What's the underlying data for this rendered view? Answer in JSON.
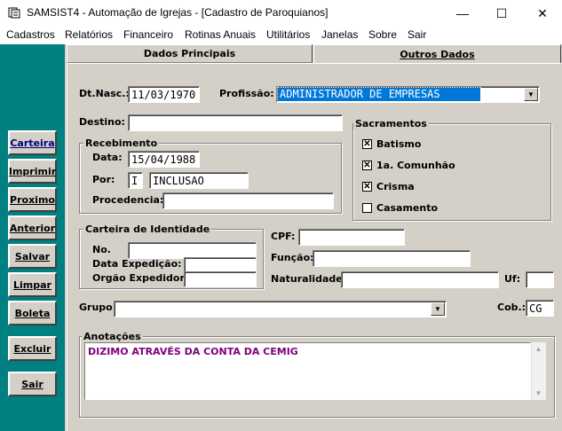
{
  "window": {
    "title": "SAMSIST4 - Automação de Igrejas - [Cadastro de Paroquianos]",
    "icon": "app-icon",
    "minimize": "—",
    "maximize": "☐",
    "close": "✕"
  },
  "menubar": [
    "Cadastros",
    "Relatórios",
    "Financeiro",
    "Rotinas Anuais",
    "Utilitários",
    "Janelas",
    "Sobre",
    "Sair"
  ],
  "sidebar": {
    "carteira": "Carteira",
    "imprimir": "Imprimir",
    "proximo": "Proximo",
    "anterior": "Anterior",
    "salvar": "Salvar",
    "limpar": "Limpar",
    "boleta": "Boleta",
    "excluir": "Excluir",
    "sair": "Sair"
  },
  "tabs": {
    "dados_principais": "Dados Principais",
    "outros_dados": "Outros Dados"
  },
  "form": {
    "dtnasc_label": "Dt.Nasc.:",
    "dtnasc_value": "11/03/1970",
    "profissao_label": "Profissão:",
    "profissao_value": "ADMINISTRADOR DE EMPRESAS",
    "destino_label": "Destino:",
    "destino_value": "",
    "recebimento_title": "Recebimento",
    "data_label": "Data:",
    "data_value": "15/04/1988",
    "por_label": "Por:",
    "por_code": "I",
    "por_value": "INCLUSAO",
    "procedencia_label": "Procedencia:",
    "procedencia_value": "",
    "sacramentos_title": "Sacramentos",
    "sacramentos": [
      {
        "label": "Batismo",
        "checked": true
      },
      {
        "label": "1a. Comunhão",
        "checked": true
      },
      {
        "label": "Crisma",
        "checked": true
      },
      {
        "label": "Casamento",
        "checked": false
      }
    ],
    "carteira_title": "Carteira de Identidade",
    "no_label": "No.",
    "no_value": "",
    "data_expedicao_label": "Data Expedição:",
    "data_expedicao_value": "",
    "orgao_label": "Orgão Expedidor:",
    "orgao_value": "",
    "cpf_label": "CPF:",
    "cpf_value": "",
    "funcao_label": "Função:",
    "funcao_value": "",
    "naturalidade_label": "Naturalidade:",
    "naturalidade_value": "",
    "uf_label": "Uf:",
    "uf_value": "",
    "grupo_label": "Grupo:",
    "grupo_value": "",
    "cob_label": "Cob.:",
    "cob_value": "CG",
    "anotacoes_title": "Anotações",
    "anotacoes_value": "DIZIMO ATRAVÉS DA CONTA DA CEMIG"
  },
  "colors": {
    "sidebar_bg": "#008080",
    "selection_bg": "#0078d7",
    "memo_text": "#800080",
    "active_button_text": "#000080"
  }
}
